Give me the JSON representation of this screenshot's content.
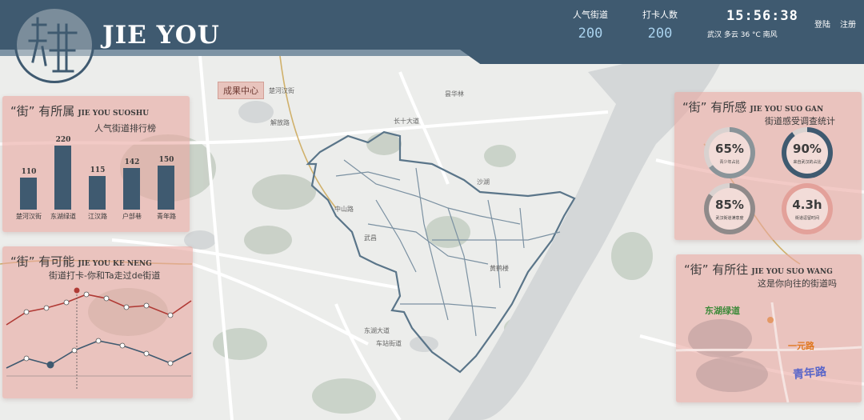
{
  "header": {
    "logo_text": "JIE YOU",
    "stats": [
      {
        "label": "人气街道",
        "value": "200"
      },
      {
        "label": "打卡人数",
        "value": "200"
      }
    ],
    "clock": "15:56:38",
    "weather": "武汉  多云    36 °C  南风",
    "login": "登陆",
    "register": "注册"
  },
  "map": {
    "center_label": "成果中心",
    "labels": [
      "东湖大道",
      "车站街道",
      "昙华林",
      "黄鹤楼",
      "沙湖",
      "武昌",
      "长十大道",
      "解放路",
      "中山路",
      "楚河汉街"
    ]
  },
  "panel_ranking": {
    "title": "“街” 有所属",
    "title_en": "JIE YOU SUOSHU",
    "subtitle": "人气街道排行榜"
  },
  "panel_feel": {
    "title": "“街” 有所感",
    "title_en": "JIE YOU SUO GAN",
    "subtitle": "街道感受调查统计",
    "rings": [
      {
        "value": "65%",
        "caption": "青少年占比",
        "pct": 65,
        "color": "#8a9499"
      },
      {
        "value": "90%",
        "caption": "来自武汉的占比",
        "pct": 90,
        "color": "#3f5a70"
      },
      {
        "value": "85%",
        "caption": "武汉街道满意度",
        "pct": 85,
        "color": "#8f8a8a"
      },
      {
        "value": "4.3h",
        "caption": "街道逗留时间",
        "pct": 100,
        "color": "#e3a19a"
      }
    ]
  },
  "panel_possible": {
    "title": "“街” 有可能",
    "title_en": "JIE YOU KE NENG",
    "subtitle": "街道打卡-你和Ta走过de街道"
  },
  "panel_wish": {
    "title": "“街” 有所往",
    "title_en": "JIE YOU SUO WANG",
    "subtitle": "这是你向往的街道吗",
    "streets": [
      {
        "name": "东湖绿道",
        "color": "#3e8a3a"
      },
      {
        "name": "一元路",
        "color": "#e0771f"
      },
      {
        "name": "青年路",
        "color": "#5a66c9"
      }
    ]
  },
  "chart_data": {
    "type": "bar",
    "categories": [
      "楚河汉街",
      "东湖绿道",
      "江汉路",
      "户部巷",
      "青年路"
    ],
    "values": [
      110,
      220,
      115,
      142,
      150
    ]
  }
}
